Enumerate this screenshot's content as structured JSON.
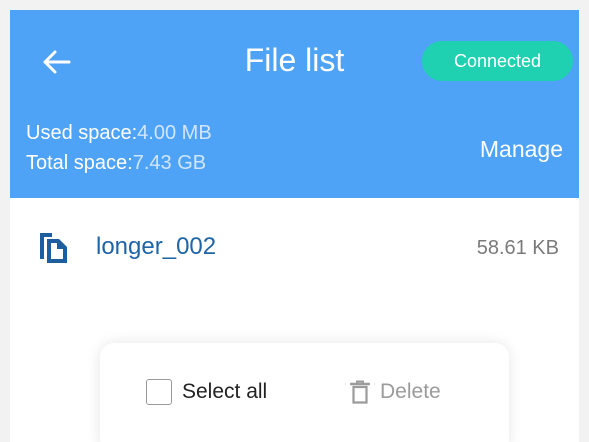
{
  "header": {
    "title": "File list",
    "status": "Connected",
    "back_icon": "arrow-left-icon",
    "used_space_label": "Used space:",
    "used_space_value": "4.00 MB",
    "total_space_label": "Total space:",
    "total_space_value": "7.43 GB",
    "manage_label": "Manage"
  },
  "files": [
    {
      "name": "longer_002",
      "size": "58.61 KB",
      "icon": "file-copy-icon"
    }
  ],
  "action_bar": {
    "select_all_label": "Select all",
    "delete_label": "Delete",
    "delete_icon": "trash-icon"
  },
  "colors": {
    "header_bg": "#4fa3f7",
    "status_bg": "#1fd1b0",
    "file_name": "#2064a8",
    "file_icon": "#1f5e9e"
  }
}
